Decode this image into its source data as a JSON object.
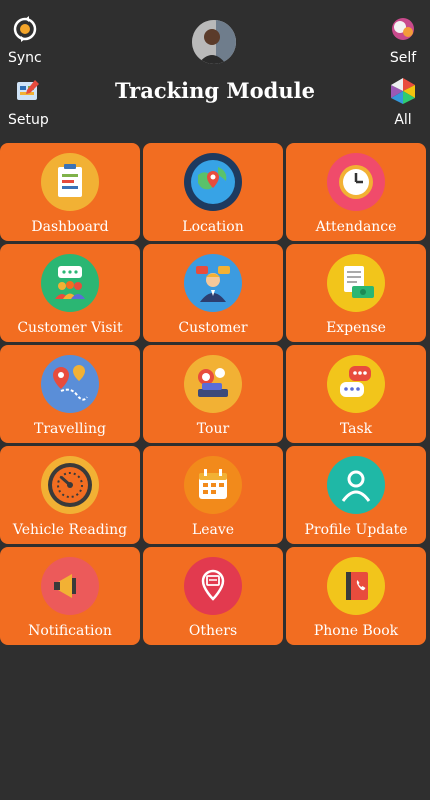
{
  "header": {
    "title": "Tracking Module",
    "sync_label": "Sync",
    "setup_label": "Setup",
    "self_label": "Self",
    "all_label": "All"
  },
  "tiles": [
    {
      "label": "Dashboard",
      "icon": "dashboard-icon"
    },
    {
      "label": "Location",
      "icon": "location-icon"
    },
    {
      "label": "Attendance",
      "icon": "attendance-icon"
    },
    {
      "label": "Customer Visit",
      "icon": "customer-visit-icon"
    },
    {
      "label": "Customer",
      "icon": "customer-icon"
    },
    {
      "label": "Expense",
      "icon": "expense-icon"
    },
    {
      "label": "Travelling",
      "icon": "travelling-icon"
    },
    {
      "label": "Tour",
      "icon": "tour-icon"
    },
    {
      "label": "Task",
      "icon": "task-icon"
    },
    {
      "label": "Vehicle Reading",
      "icon": "vehicle-reading-icon"
    },
    {
      "label": "Leave",
      "icon": "leave-icon"
    },
    {
      "label": "Profile Update",
      "icon": "profile-update-icon"
    },
    {
      "label": "Notification",
      "icon": "notification-icon"
    },
    {
      "label": "Others",
      "icon": "others-icon"
    },
    {
      "label": "Phone Book",
      "icon": "phone-book-icon"
    }
  ],
  "colors": {
    "background": "#2f2f2f",
    "tile": "#f26d21",
    "text": "#ffffff"
  }
}
